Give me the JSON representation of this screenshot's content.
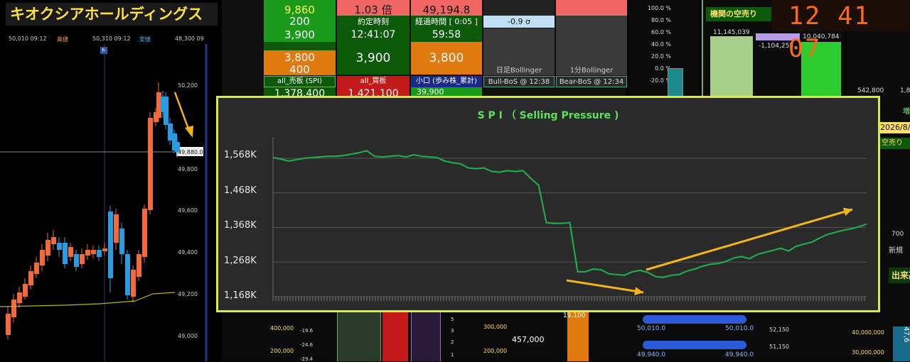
{
  "header": {
    "title": "キオクシアホールディングス",
    "clock": "12 41 07"
  },
  "left_chart": {
    "top_labels": [
      "50,010 09:12",
      "高値",
      "50,310 09:12",
      "安値",
      "48,300 09"
    ],
    "marker": "N",
    "y_ticks": [
      "50,200",
      "49,880.0",
      "49,800",
      "49,600",
      "49,400",
      "49,200",
      "49,000"
    ],
    "price_tag": "49,880.0",
    "colors": {
      "up": "#f06a3a",
      "down": "#2a9be0",
      "ma": "#b8b02a"
    }
  },
  "board": {
    "r0": [
      "9,860",
      "1.03 倍",
      "49,194.8"
    ],
    "r1": [
      "200",
      "約定時刻",
      "経過時間 [ 0:05 ]",
      "-0.9 σ"
    ],
    "r2": [
      "3,900",
      "12:41:07",
      "59:58"
    ],
    "r3": [
      "3,800",
      "3,900",
      "3,800"
    ],
    "r4": [
      "400"
    ],
    "bollinger": [
      "日足Bollinger",
      "1分Bollinger"
    ],
    "r5": [
      "all_売板 (SPI)",
      "all_買板",
      "小口 (歩み株_累計)",
      "Bull-BoS @ 12:38",
      "Bear-BoS @ 12:34"
    ],
    "r6": [
      "1,378,400",
      "1,421,100",
      "39,900"
    ]
  },
  "pct_axis": [
    "100.0 %",
    "80.0 %",
    "60.0 %",
    "40.0 %",
    "20.0 %",
    "0.0 %",
    "-20.0 %"
  ],
  "short_panel": {
    "title": "機関の空売り",
    "values": [
      "11,145,039",
      "-1,104,255",
      "10,040,784"
    ]
  },
  "right_strip": {
    "vals": [
      "542,800",
      "1,8"
    ],
    "labels": [
      "増",
      "2026/8/",
      "空売り",
      "700",
      "新規",
      "出来高"
    ]
  },
  "spi_chart": {
    "title": "S P I （ Selling Pressure )",
    "y_ticks": [
      "1,568K",
      "1,468K",
      "1,368K",
      "1,268K",
      "1,168K"
    ]
  },
  "chart_data": {
    "type": "line",
    "title": "S P I （ Selling Pressure )",
    "xlabel": "",
    "ylabel": "",
    "ylim": [
      1168,
      1618
    ],
    "grid": true,
    "series": [
      {
        "values": [
          1570,
          1566,
          1560,
          1564,
          1568,
          1570,
          1572,
          1574,
          1574,
          1576,
          1580,
          1584,
          1590,
          1574,
          1572,
          1574,
          1576,
          1572,
          1578,
          1574,
          1572,
          1570,
          1560,
          1555,
          1552,
          1540,
          1538,
          1540,
          1530,
          1528,
          1532,
          1530,
          1532,
          1510,
          1490,
          1382,
          1380,
          1380,
          1382,
          1240,
          1240,
          1248,
          1246,
          1234,
          1232,
          1230,
          1240,
          1244,
          1238,
          1226,
          1224,
          1230,
          1232,
          1242,
          1248,
          1256,
          1262,
          1264,
          1270,
          1280,
          1284,
          1278,
          1290,
          1296,
          1302,
          1308,
          1300,
          1314,
          1320,
          1326,
          1338,
          1348,
          1354,
          1360,
          1364,
          1370,
          1378
        ]
      }
    ],
    "annotations": [
      "down-arrow-left",
      "down-arrow-low",
      "up-arrow-right"
    ]
  },
  "bottom": {
    "left_axis": [
      "400,000",
      "200,000"
    ],
    "mini_axis": [
      "-19.6",
      "-24.6",
      "-29.4"
    ],
    "small_ticks": [
      "5",
      "3",
      "2",
      "1"
    ],
    "mid_axis": [
      "300,000",
      "200,000"
    ],
    "value": "457,000",
    "value2": "19,100",
    "blue_bars": [
      "50,010.0",
      "50,010.0",
      "49,940.0",
      "49,940.0"
    ],
    "right_axis": [
      "52,150",
      "51,150"
    ],
    "far_axis": [
      "40,000,000",
      "30,000,000"
    ],
    "far_val": "47,6"
  }
}
